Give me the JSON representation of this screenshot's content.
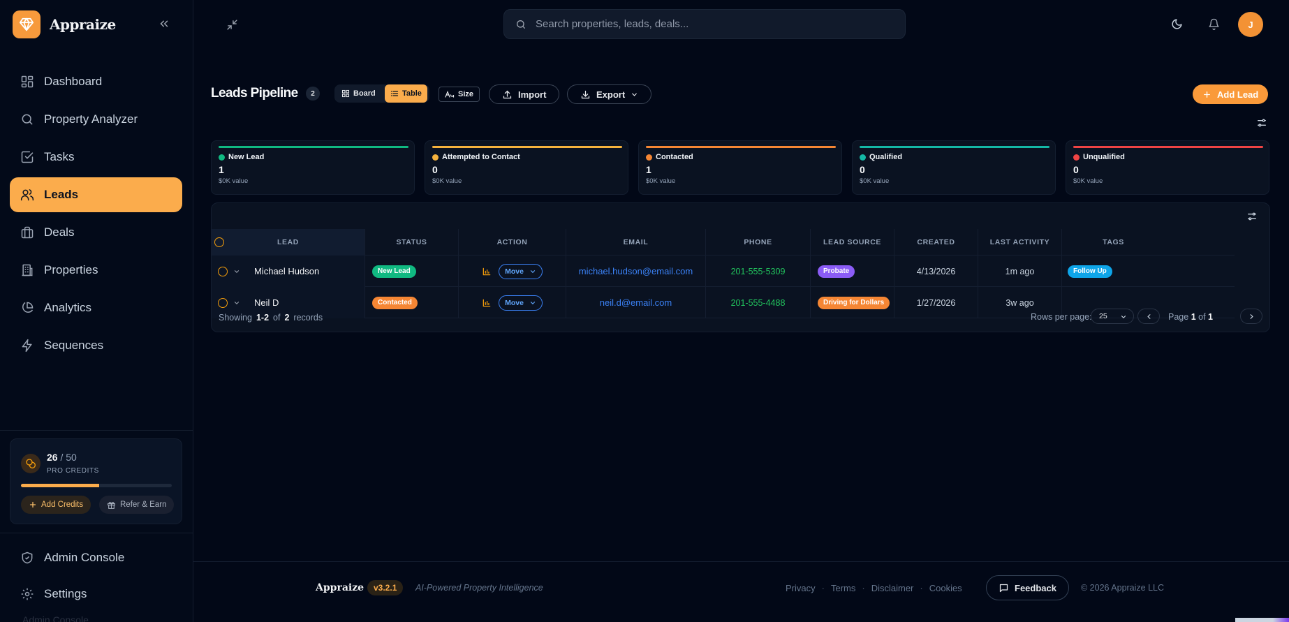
{
  "brand": {
    "name": "Appraize"
  },
  "sidebar": {
    "items": [
      {
        "label": "Dashboard",
        "icon": "grid-icon"
      },
      {
        "label": "Property Analyzer",
        "icon": "search-icon"
      },
      {
        "label": "Tasks",
        "icon": "checkbox-icon"
      },
      {
        "label": "Leads",
        "icon": "users-icon",
        "active": true
      },
      {
        "label": "Deals",
        "icon": "briefcase-icon"
      },
      {
        "label": "Properties",
        "icon": "building-icon"
      },
      {
        "label": "Analytics",
        "icon": "pie-chart-icon"
      },
      {
        "label": "Sequences",
        "icon": "bolt-icon"
      }
    ],
    "credits": {
      "used": "26",
      "separator": "/",
      "total": "50",
      "label": "PRO CREDITS",
      "progress": 0.52,
      "add_label": "Add Credits",
      "refer_label": "Refer & Earn"
    },
    "bottom": [
      {
        "label": "Admin Console",
        "icon": "shield-icon"
      },
      {
        "label": "Settings",
        "icon": "gear-icon"
      }
    ],
    "ghost_label": "Admin Console"
  },
  "topbar": {
    "search_placeholder": "Search properties, leads, deals...",
    "avatar_initial": "J"
  },
  "page": {
    "title": "Leads Pipeline",
    "count": "2",
    "view_board": "Board",
    "view_table": "Table",
    "size_label": "Size",
    "import_label": "Import",
    "export_label": "Export",
    "add_lead_label": "Add Lead"
  },
  "stages": [
    {
      "name": "New Lead",
      "count": "1",
      "value": "$0K value",
      "color": "#10b981"
    },
    {
      "name": "Attempted to Contact",
      "count": "0",
      "value": "$0K value",
      "color": "#f5b23d"
    },
    {
      "name": "Contacted",
      "count": "1",
      "value": "$0K value",
      "color": "#f58634"
    },
    {
      "name": "Qualified",
      "count": "0",
      "value": "$0K value",
      "color": "#14b8a6"
    },
    {
      "name": "Unqualified",
      "count": "0",
      "value": "$0K value",
      "color": "#ef4444"
    }
  ],
  "table": {
    "columns": [
      "LEAD",
      "STATUS",
      "ACTION",
      "EMAIL",
      "PHONE",
      "LEAD SOURCE",
      "CREATED",
      "LAST ACTIVITY",
      "TAGS"
    ],
    "rows": [
      {
        "lead": "Michael Hudson",
        "status": "New Lead",
        "status_color": "#10b981",
        "action": "Move",
        "email": "michael.hudson@email.com",
        "phone": "201-555-5309",
        "source": "Probate",
        "source_color": "#8b5cf6",
        "created": "4/13/2026",
        "last_activity": "1m ago",
        "tag": "Follow Up"
      },
      {
        "lead": "Neil D",
        "status": "Contacted",
        "status_color": "#f58634",
        "action": "Move",
        "email": "neil.d@email.com",
        "phone": "201-555-4488",
        "source": "Driving for Dollars",
        "source_color": "#f58634",
        "created": "1/27/2026",
        "last_activity": "3w ago",
        "tag": ""
      }
    ],
    "footer": {
      "showing": "Showing",
      "range": "1-2",
      "of": "of",
      "total": "2",
      "records": "records",
      "rows_per_page_label": "Rows per page:",
      "rows_per_page": "25",
      "page_label": "Page",
      "page": "1",
      "page_of": "of",
      "page_total": "1"
    }
  },
  "footer": {
    "brand": "Appraize",
    "version": "v3.2.1",
    "tagline": "AI-Powered Property Intelligence",
    "links": [
      "Privacy",
      "Terms",
      "Disclaimer",
      "Cookies"
    ],
    "feedback": "Feedback",
    "copyright": "© 2026 Appraize LLC"
  }
}
